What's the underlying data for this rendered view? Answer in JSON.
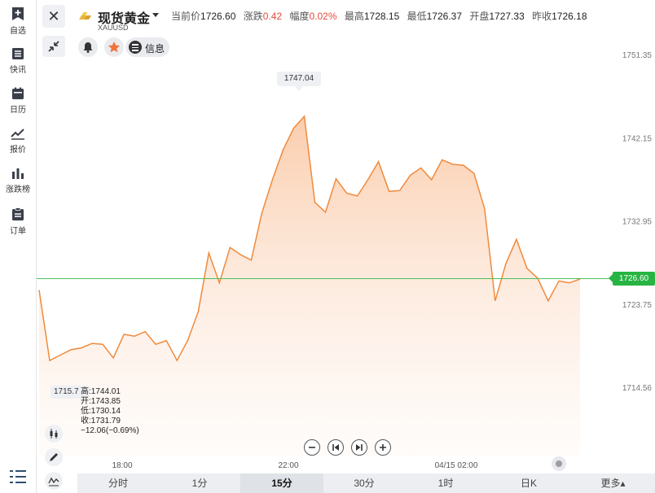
{
  "sidebar": {
    "items": [
      {
        "label": "自选",
        "icon": "bookmark-plus-icon"
      },
      {
        "label": "快讯",
        "icon": "news-list-icon"
      },
      {
        "label": "日历",
        "icon": "calendar-icon"
      },
      {
        "label": "报价",
        "icon": "quote-line-icon"
      },
      {
        "label": "涨跌榜",
        "icon": "bar-rank-icon"
      },
      {
        "label": "订单",
        "icon": "order-clipboard-icon"
      }
    ],
    "bottom_icon": "menu-list-icon"
  },
  "header": {
    "title": "现货黄金",
    "symbol": "XAUUSD",
    "stats": [
      {
        "label": "当前价",
        "value": "1726.60",
        "color": "normal"
      },
      {
        "label": "涨跌",
        "value": "0.42",
        "color": "up"
      },
      {
        "label": "幅度",
        "value": "0.02%",
        "color": "up"
      },
      {
        "label": "最高",
        "value": "1728.15",
        "color": "normal"
      },
      {
        "label": "最低",
        "value": "1726.37",
        "color": "normal"
      },
      {
        "label": "开盘",
        "value": "1727.33",
        "color": "normal"
      },
      {
        "label": "昨收",
        "value": "1726.18",
        "color": "normal"
      }
    ],
    "info_label": "信息"
  },
  "chart": {
    "current_price": "1726.60",
    "max_label": "1747.04",
    "min_label": "1715.7",
    "ohlc": {
      "high": "高:1744.01",
      "open": "开:1743.85",
      "low": "低:1730.14",
      "close": "收:1731.79",
      "change": "−12.06(−0.69%)"
    }
  },
  "chart_data": {
    "type": "area",
    "x_ticks": [
      "18:00",
      "22:00",
      "04/15 02:00"
    ],
    "y_ticks": [
      "1751.35",
      "1742.15",
      "1732.95",
      "1723.75",
      "1714.56"
    ],
    "ylim": [
      1714.56,
      1751.35
    ],
    "reference_line": 1726.6,
    "values": [
      1725.4,
      1717.6,
      1718.2,
      1718.8,
      1719.0,
      1719.5,
      1719.4,
      1717.9,
      1720.5,
      1720.3,
      1720.8,
      1719.4,
      1719.8,
      1717.6,
      1719.8,
      1723.0,
      1729.5,
      1726.2,
      1730.1,
      1729.3,
      1728.7,
      1733.9,
      1737.6,
      1740.9,
      1743.3,
      1744.6,
      1735.1,
      1734.0,
      1737.7,
      1736.1,
      1735.8,
      1737.6,
      1739.6,
      1736.3,
      1736.4,
      1738.1,
      1738.9,
      1737.6,
      1739.8,
      1739.3,
      1739.2,
      1738.3,
      1734.4,
      1724.2,
      1728.3,
      1731.0,
      1727.8,
      1726.7,
      1724.2,
      1726.4,
      1726.2,
      1726.6
    ],
    "line_color": "#f08a3c",
    "grid": false
  },
  "controls": {
    "zoom_out_icon": "zoom-out-icon",
    "prev_icon": "skip-back-icon",
    "next_icon": "skip-forward-icon",
    "zoom_in_icon": "zoom-in-icon"
  },
  "tabs": [
    {
      "label": "分时",
      "active": false
    },
    {
      "label": "1分",
      "active": false
    },
    {
      "label": "15分",
      "active": true
    },
    {
      "label": "30分",
      "active": false
    },
    {
      "label": "1时",
      "active": false
    },
    {
      "label": "日K",
      "active": false
    },
    {
      "label": "更多▴",
      "active": false
    }
  ]
}
